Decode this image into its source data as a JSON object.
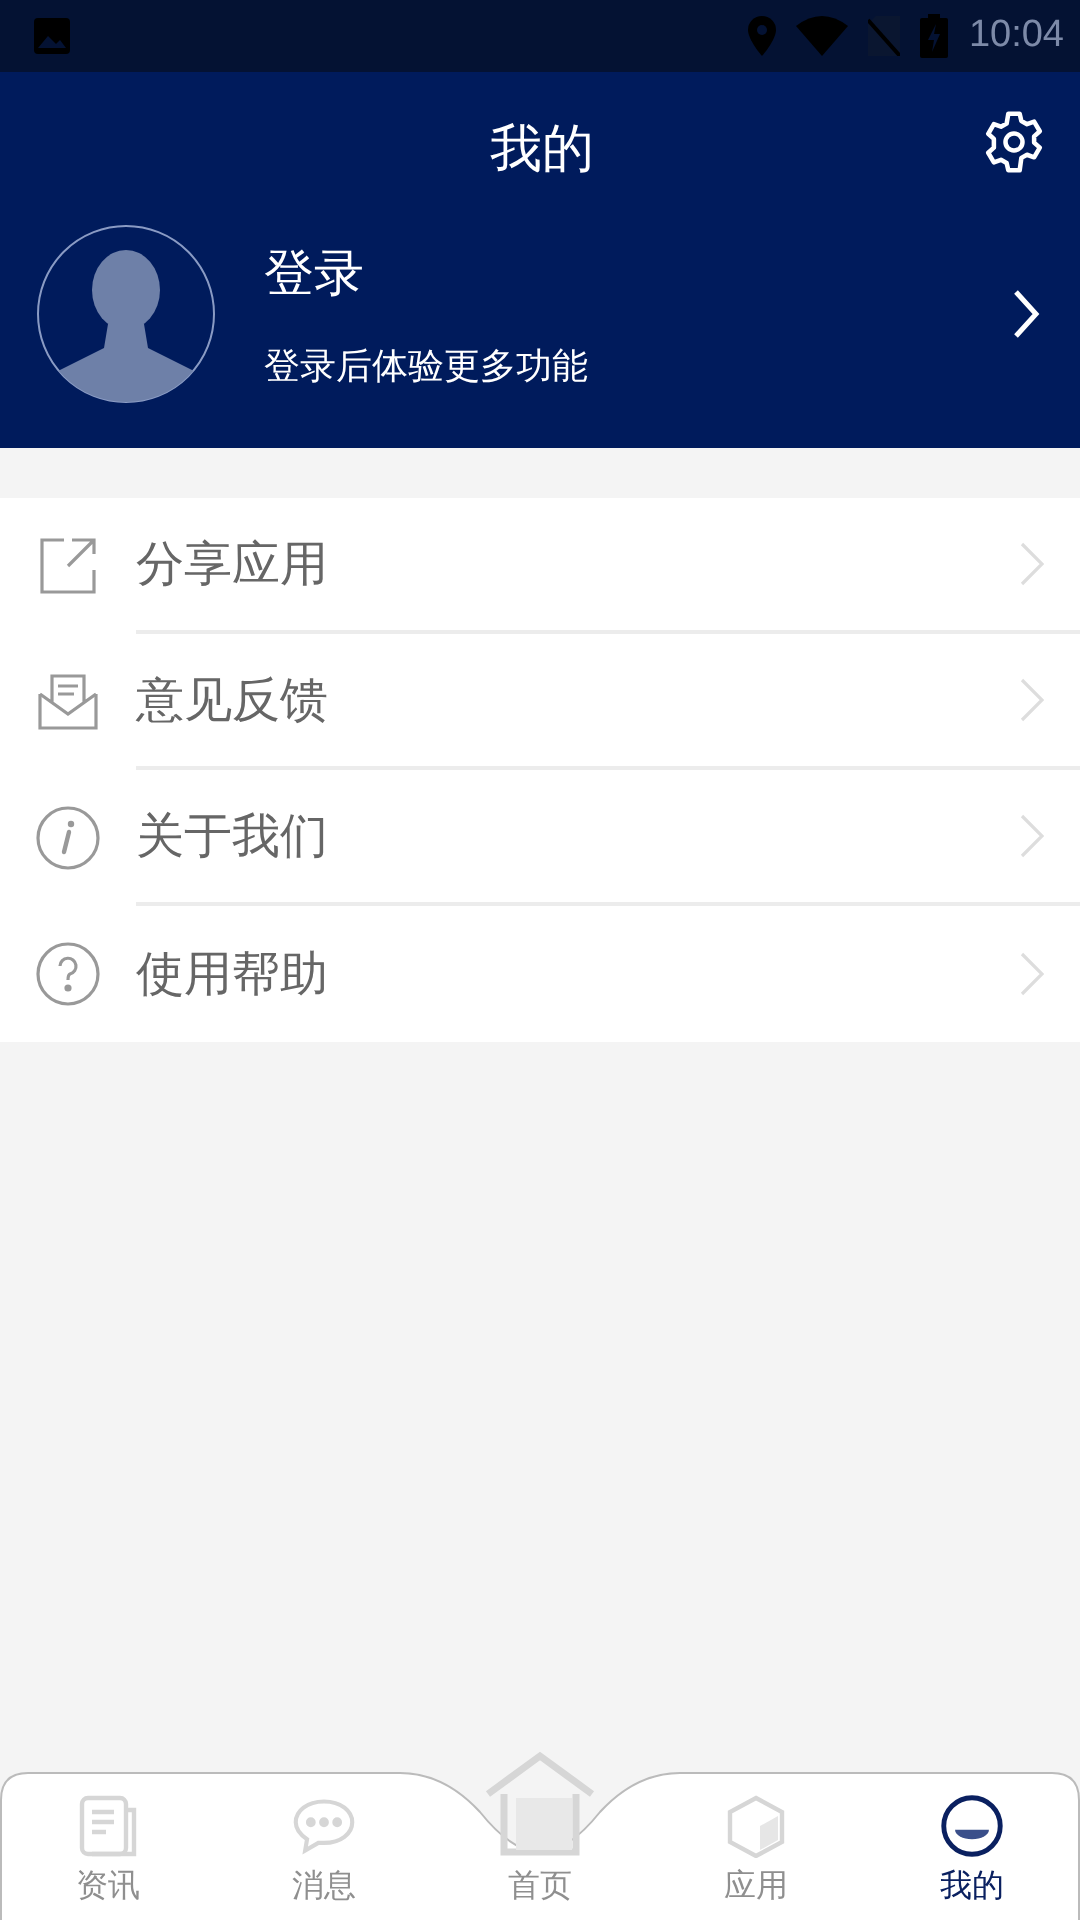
{
  "status_bar": {
    "time": "10:04"
  },
  "header": {
    "title": "我的"
  },
  "profile": {
    "name": "登录",
    "subtitle": "登录后体验更多功能"
  },
  "menu": [
    {
      "kind": "share",
      "label": "分享应用"
    },
    {
      "kind": "feedback",
      "label": "意见反馈"
    },
    {
      "kind": "about",
      "label": "关于我们"
    },
    {
      "kind": "help",
      "label": "使用帮助"
    }
  ],
  "tabs": [
    {
      "kind": "news",
      "label": "资讯",
      "selected": false
    },
    {
      "kind": "messages",
      "label": "消息",
      "selected": false
    },
    {
      "kind": "home",
      "label": "首页",
      "selected": false
    },
    {
      "kind": "apps",
      "label": "应用",
      "selected": false
    },
    {
      "kind": "me",
      "label": "我的",
      "selected": true
    }
  ]
}
